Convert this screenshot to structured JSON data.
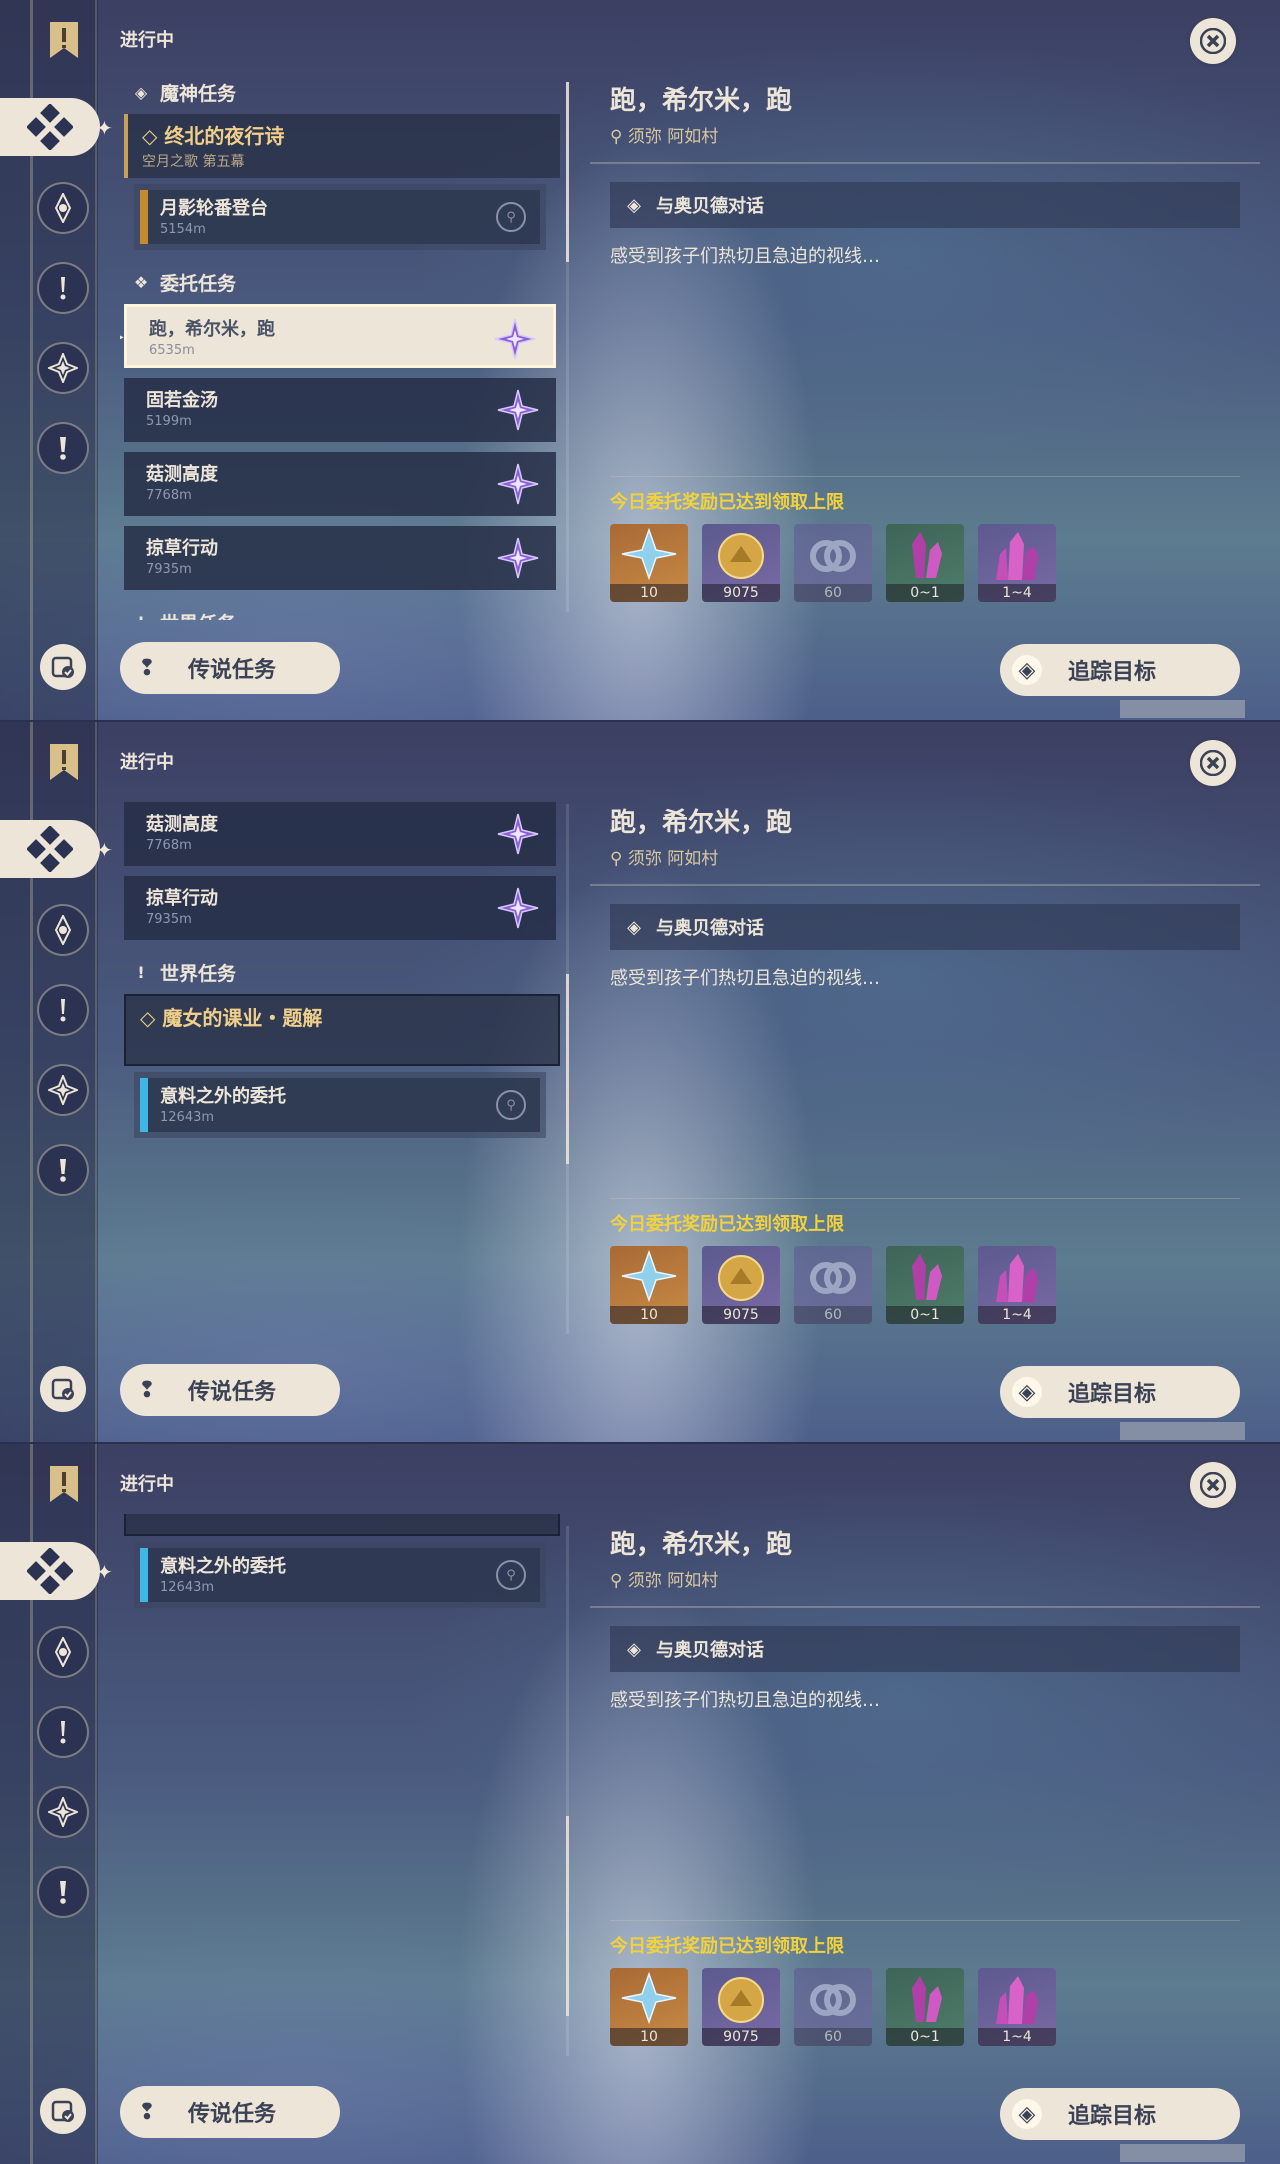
{
  "header": {
    "status_label": "进行中"
  },
  "sections": {
    "archon": "魔神任务",
    "commission": "委托任务",
    "world": "世界任务"
  },
  "archon_quest": {
    "title": "终北的夜行诗",
    "subtitle": "空月之歌 第五幕"
  },
  "archon_sub": {
    "title": "月影轮番登台",
    "distance": "5154m"
  },
  "commissions": [
    {
      "title": "跑，希尔米，跑",
      "distance": "6535m"
    },
    {
      "title": "固若金汤",
      "distance": "5199m"
    },
    {
      "title": "菇测高度",
      "distance": "7768m"
    },
    {
      "title": "掠草行动",
      "distance": "7935m"
    }
  ],
  "world_quest": {
    "title": "魔女的课业・题解"
  },
  "world_sub": {
    "title": "意料之外的委托",
    "distance": "12643m"
  },
  "detail": {
    "title": "跑，希尔米，跑",
    "location": "须弥 阿如村",
    "objective": "与奥贝德对话",
    "description": "感受到孩子们热切且急迫的视线…",
    "reward_notice": "今日委托奖励已达到领取上限",
    "rewards": [
      {
        "icon": "primogem-icon",
        "count": "10"
      },
      {
        "icon": "mora-icon",
        "count": "9075"
      },
      {
        "icon": "adventure-exp-icon",
        "count": "60"
      },
      {
        "icon": "crystal-icon",
        "count": "0~1"
      },
      {
        "icon": "crystal-cluster-icon",
        "count": "1~4"
      }
    ]
  },
  "buttons": {
    "legend": "传说任务",
    "track": "追踪目标"
  },
  "colors": {
    "accent_gold": "#f0cf8a",
    "reward_yellow": "#f2d23c",
    "panel_cream": "#ece5d8"
  }
}
